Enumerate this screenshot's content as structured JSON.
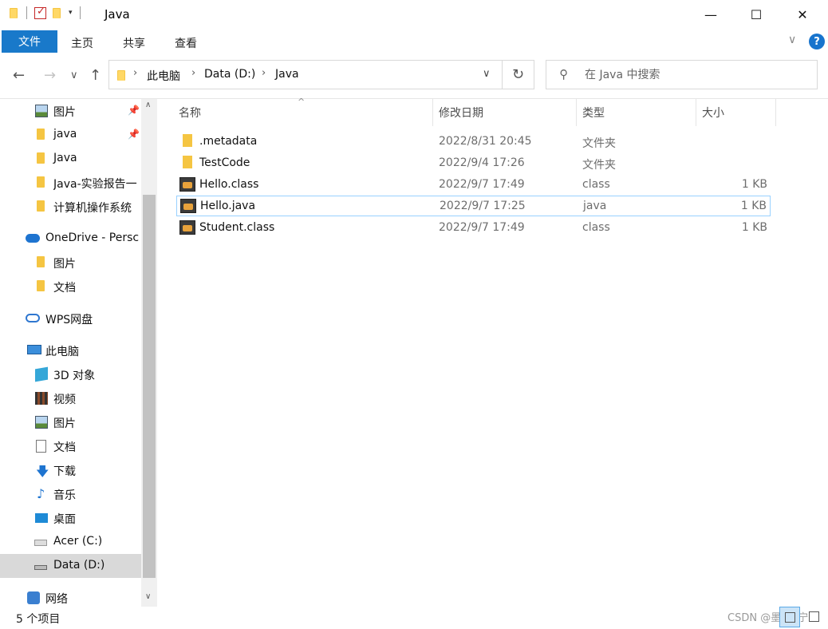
{
  "window": {
    "title": "Java",
    "controls": {
      "minimize": "—",
      "maximize": "☐",
      "close": "✕"
    }
  },
  "ribbon": {
    "file_tab": "文件",
    "tabs": [
      "主页",
      "共享",
      "查看"
    ],
    "help_label": "?",
    "collapse_glyph": "∨"
  },
  "address": {
    "back": "←",
    "forward": "→",
    "recent": "∨",
    "up": "↑",
    "breadcrumbs": [
      "此电脑",
      "Data (D:)",
      "Java"
    ],
    "separator": "›",
    "dropdown": "∨",
    "refresh": "↻"
  },
  "search": {
    "placeholder": "在 Java 中搜索",
    "icon": "search-icon"
  },
  "sidebar": {
    "items": [
      {
        "label": "图片",
        "icon": "pictures-icon",
        "pinned": true
      },
      {
        "label": "java",
        "icon": "folder-icon",
        "pinned": true
      },
      {
        "label": "Java",
        "icon": "folder-icon",
        "pinned": false
      },
      {
        "label": "Java-实验报告一",
        "icon": "folder-icon",
        "pinned": false
      },
      {
        "label": "计算机操作系统",
        "icon": "folder-icon",
        "pinned": false
      },
      {
        "label": "OneDrive - Persc",
        "icon": "onedrive-icon",
        "pinned": false
      },
      {
        "label": "图片",
        "icon": "folder-icon",
        "pinned": false
      },
      {
        "label": "文档",
        "icon": "folder-icon",
        "pinned": false
      },
      {
        "label": "WPS网盘",
        "icon": "wps-cloud-icon",
        "pinned": false
      },
      {
        "label": "此电脑",
        "icon": "this-pc-icon",
        "pinned": false
      },
      {
        "label": "3D 对象",
        "icon": "3d-objects-icon",
        "pinned": false
      },
      {
        "label": "视频",
        "icon": "videos-icon",
        "pinned": false
      },
      {
        "label": "图片",
        "icon": "pictures-icon",
        "pinned": false
      },
      {
        "label": "文档",
        "icon": "documents-icon",
        "pinned": false
      },
      {
        "label": "下载",
        "icon": "downloads-icon",
        "pinned": false
      },
      {
        "label": "音乐",
        "icon": "music-icon",
        "pinned": false
      },
      {
        "label": "桌面",
        "icon": "desktop-icon",
        "pinned": false
      },
      {
        "label": "Acer (C:)",
        "icon": "drive-c-icon",
        "pinned": false
      },
      {
        "label": "Data (D:)",
        "icon": "drive-d-icon",
        "pinned": false,
        "selected": true
      },
      {
        "label": "网络",
        "icon": "network-icon",
        "pinned": false
      }
    ],
    "pin_glyph": "📌",
    "scroll_up": "∧",
    "scroll_down": "∨"
  },
  "file_list": {
    "columns": [
      "名称",
      "修改日期",
      "类型",
      "大小"
    ],
    "sort_indicator": "^",
    "rows": [
      {
        "name": ".metadata",
        "date": "2022/8/31 20:45",
        "type": "文件夹",
        "size": "",
        "icon": "folder-icon"
      },
      {
        "name": "TestCode",
        "date": "2022/9/4 17:26",
        "type": "文件夹",
        "size": "",
        "icon": "folder-icon"
      },
      {
        "name": "Hello.class",
        "date": "2022/9/7 17:49",
        "type": "class",
        "size": "1 KB",
        "icon": "java-file-icon"
      },
      {
        "name": "Hello.java",
        "date": "2022/9/7 17:25",
        "type": "java",
        "size": "1 KB",
        "icon": "java-file-icon",
        "focused": true
      },
      {
        "name": "Student.class",
        "date": "2022/9/7 17:49",
        "type": "class",
        "size": "1 KB",
        "icon": "java-file-icon"
      }
    ]
  },
  "status": {
    "item_count": "5 个项目",
    "watermark": "CSDN @墨染e宁"
  },
  "colors": {
    "file_tab": "#1979ca",
    "selection": "#d9d9d9",
    "focus_border": "#99d1ff",
    "folder": "#f5c542"
  }
}
